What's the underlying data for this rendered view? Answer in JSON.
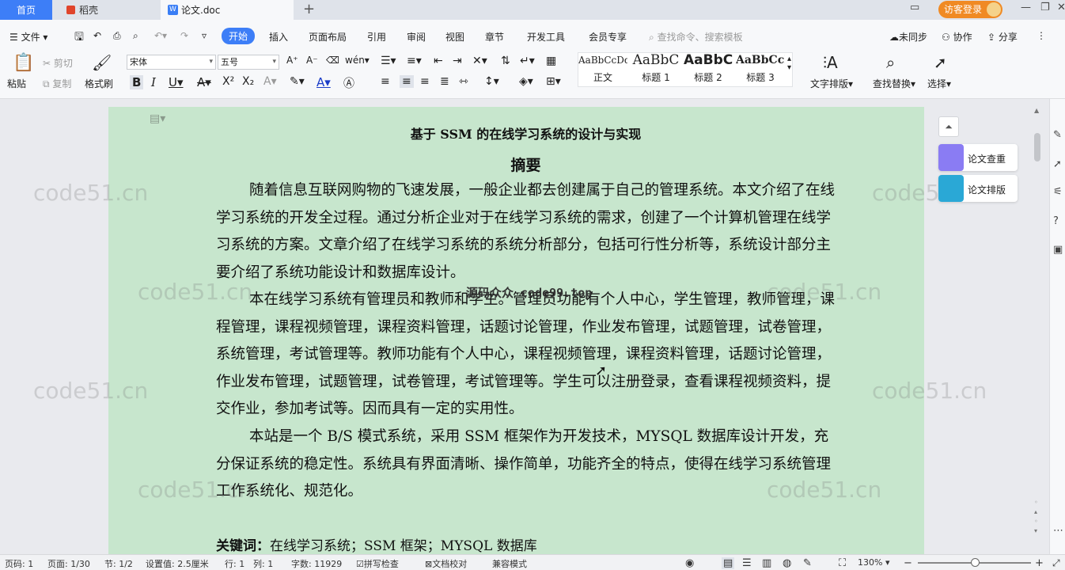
{
  "tabs": {
    "home": "首页",
    "wenku": "稻壳",
    "doc": "论文.doc"
  },
  "titlebar": {
    "guest_login": "访客登录"
  },
  "menu": {
    "file": "文件",
    "items": [
      "开始",
      "插入",
      "页面布局",
      "引用",
      "审阅",
      "视图",
      "章节",
      "开发工具",
      "会员专享"
    ],
    "search_placeholder": "查找命令、搜索模板",
    "not_synced": "未同步",
    "collaborate": "协作",
    "share": "分享"
  },
  "ribbon": {
    "paste": "粘贴",
    "cut": "剪切",
    "copy": "复制",
    "format_painter": "格式刷",
    "font_name": "宋体",
    "font_size": "五号",
    "styles": [
      {
        "preview": "AaBbCcDd",
        "label": "正文"
      },
      {
        "preview": "AaBbC",
        "label": "标题 1"
      },
      {
        "preview": "AaBbC",
        "label": "标题 2"
      },
      {
        "preview": "AaBbCcI",
        "label": "标题 3"
      }
    ],
    "text_layout": "文字排版",
    "find_replace": "查找替换",
    "select": "选择"
  },
  "document": {
    "title": "基于 SSM 的在线学习系统的设计与实现",
    "abstract_heading": "摘要",
    "paragraphs": [
      "随着信息互联网购物的飞速发展，一般企业都去创建属于自己的管理系统。本文介绍了在线学习系统的开发全过程。通过分析企业对于在线学习系统的需求，创建了一个计算机管理在线学习系统的方案。文章介绍了在线学习系统的系统分析部分，包括可行性分析等，系统设计部分主要介绍了系统功能设计和数据库设计。",
      "本在线学习系统有管理员和教师和学生。管理员功能有个人中心，学生管理，教师管理，课程管理，课程视频管理，课程资料管理，话题讨论管理，作业发布管理，试题管理，试卷管理，系统管理，考试管理等。教师功能有个人中心，课程视频管理，课程资料管理，话题讨论管理，作业发布管理，试题管理，试卷管理，考试管理等。学生可以注册登录，查看课程视频资料，提交作业，参加考试等。因而具有一定的实用性。",
      "本站是一个 B/S 模式系统，采用 SSM 框架作为开发技术，MYSQL 数据库设计开发，充分保证系统的稳定性。系统具有界面清晰、操作简单，功能齐全的特点，使得在线学习系统管理工作系统化、规范化。"
    ],
    "keywords_label": "关键词：",
    "keywords": "在线学习系统；SSM 框架；MYSQL 数据库",
    "overlay_text": "源码众众 code99.top",
    "watermark": "code51.cn"
  },
  "side_panel": {
    "check": "论文查重",
    "layout": "论文排版"
  },
  "status": {
    "page_num": "页码: 1",
    "page": "页面: 1/30",
    "section": "节: 1/2",
    "setting": "设置值: 2.5厘米",
    "line": "行: 1",
    "col": "列: 1",
    "words": "字数: 11929",
    "spell": "拼写检查",
    "proof": "文档校对",
    "compat": "兼容模式",
    "zoom": "130%"
  },
  "colors": {
    "accent": "#3d7ef7",
    "page_bg": "#c7e6cd",
    "guest_btn": "#f08a24"
  }
}
